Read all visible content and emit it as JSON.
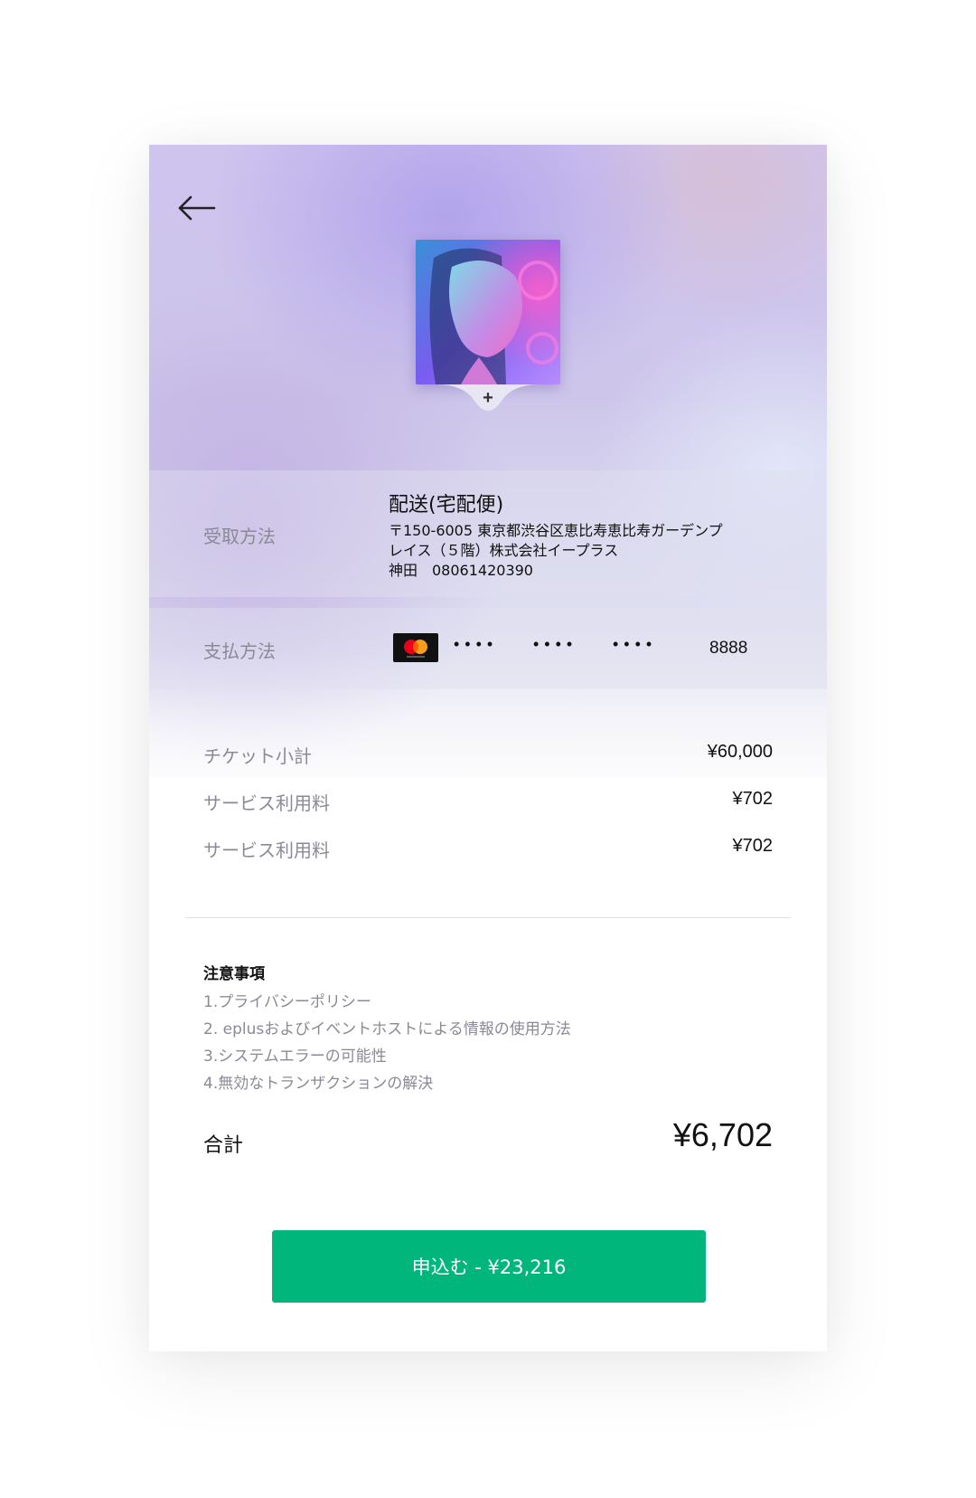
{
  "header": {
    "back_icon": "arrow-left-icon",
    "cover_icon": "event-cover-image",
    "add_icon": "plus-icon",
    "add_label": "+"
  },
  "shipping": {
    "label": "受取方法",
    "method": "配送(宅配便)",
    "address_line1": "〒150-6005 東京都渋谷区恵比寿恵比寿ガーデンプ",
    "address_line2": "レイス（５階）株式会社イープラス",
    "name_phone": "神田　08061420390"
  },
  "payment": {
    "label": "支払方法",
    "card_brand": "mastercard-icon",
    "mask_group1": "••••",
    "mask_group2": "••••",
    "mask_group3": "••••",
    "last4": "8888"
  },
  "line_items": [
    {
      "label": "チケット小計",
      "value": "¥60,000"
    },
    {
      "label": "サービス利用料",
      "value": "¥702"
    },
    {
      "label": "サービス利用料",
      "value": "¥702"
    }
  ],
  "notes": {
    "title": "注意事項",
    "items": [
      "1.プライバシーポリシー",
      "2. eplusおよびイベントホストによる情報の使用方法",
      "3.システムエラーの可能性",
      "4.無効なトランザクションの解決"
    ]
  },
  "total": {
    "label": "合計",
    "value": "¥6,702"
  },
  "submit": {
    "label": "申込む - ¥23,216"
  },
  "colors": {
    "accent": "#00b67a",
    "muted_text": "#8a8a96"
  }
}
